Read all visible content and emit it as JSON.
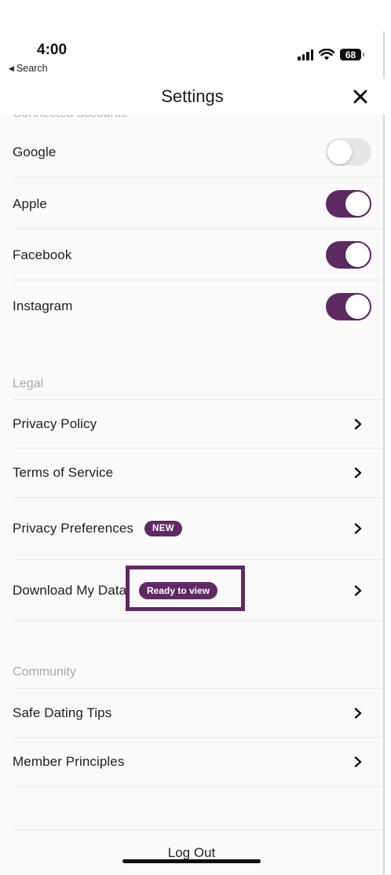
{
  "status_bar": {
    "time": "4:00",
    "back_label": "Search",
    "battery": "68"
  },
  "header": {
    "title": "Settings"
  },
  "connected_accounts": {
    "heading": "Connected accounts",
    "items": [
      {
        "label": "Google",
        "enabled": false
      },
      {
        "label": "Apple",
        "enabled": true
      },
      {
        "label": "Facebook",
        "enabled": true
      },
      {
        "label": "Instagram",
        "enabled": true
      }
    ]
  },
  "legal": {
    "heading": "Legal",
    "items": [
      {
        "label": "Privacy Policy"
      },
      {
        "label": "Terms of Service"
      },
      {
        "label": "Privacy Preferences",
        "badge": "NEW"
      },
      {
        "label": "Download My Data",
        "badge": "Ready to view"
      }
    ]
  },
  "community": {
    "heading": "Community",
    "items": [
      {
        "label": "Safe Dating Tips"
      },
      {
        "label": "Member Principles"
      }
    ]
  },
  "logout_label": "Log Out",
  "colors": {
    "accent": "#5e2a63",
    "toggle_off": "#e6e6e6",
    "background": "#fafafa"
  },
  "icons": {
    "close": "close-icon",
    "chevron": "chevron-right-icon",
    "back": "back-triangle-icon"
  }
}
